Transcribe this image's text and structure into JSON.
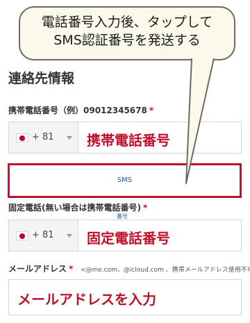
{
  "balloon": {
    "line1": "電話番号入力後、タップして",
    "line2": "SMS認証番号を発送する"
  },
  "section_title": "連絡先情報",
  "mobile": {
    "label": "携帯電話番号（例）09012345678",
    "required": "*",
    "country_code": "+ 81",
    "placeholder": "携帯電話番号"
  },
  "sms": {
    "button_label": "SMS",
    "sub_text": "番号"
  },
  "landline": {
    "label": "固定電話(無い場合は携帯電話番号)",
    "required": "*",
    "country_code": "+ 81",
    "placeholder": "固定電話番号"
  },
  "email": {
    "label": "メールアドレス",
    "required": "*",
    "hint": "<@me.com、@icloud.com 、携帯メールアドレス使用不可",
    "placeholder": "メールアドレスを入力"
  },
  "colors": {
    "accent_red": "#c0102a",
    "link_blue": "#2b4fa8",
    "balloon_fill": "#fbf9ea"
  }
}
